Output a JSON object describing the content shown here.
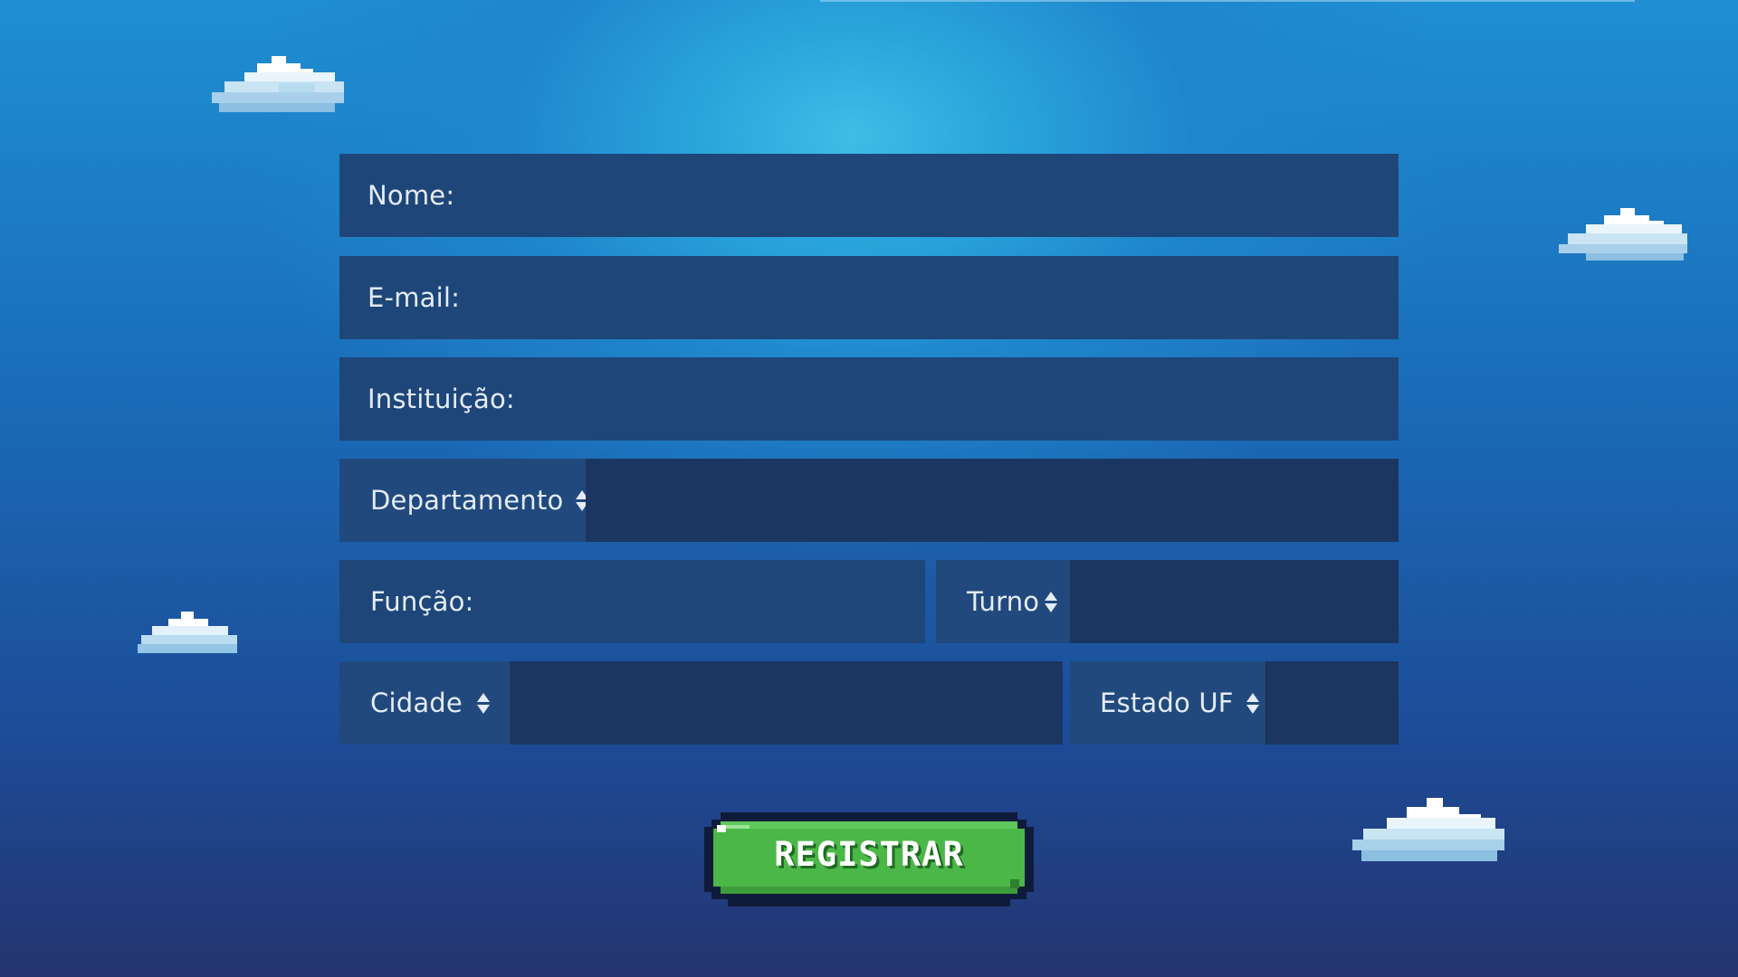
{
  "form": {
    "nome_label": "Nome:",
    "email_label": "E-mail:",
    "instituicao_label": "Instituição:",
    "departamento_label": "Departamento",
    "funcao_label": "Função:",
    "turno_label": "Turno",
    "cidade_label": "Cidade",
    "estado_label": "Estado UF"
  },
  "register_button": {
    "label": "REGISTRAR",
    "color": "#4bb748"
  },
  "theme": {
    "field_color": "#1f4679",
    "sky_color": "#1f86cc"
  },
  "decorations": {
    "clouds": [
      "cloud-icon",
      "cloud-icon",
      "cloud-icon",
      "cloud-icon"
    ]
  }
}
